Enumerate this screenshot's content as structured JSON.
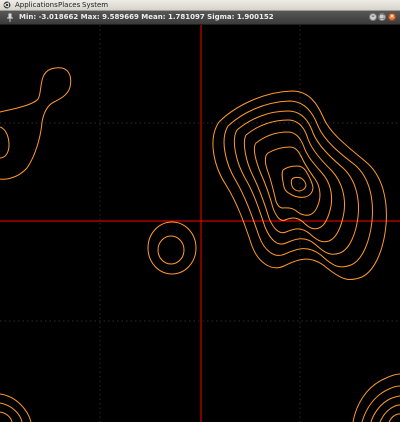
{
  "top_panel": {
    "menus": [
      "Applications",
      "Places",
      "System"
    ],
    "logo_icon": "ubuntu-logo-icon"
  },
  "window": {
    "title": "Min: -3.018662 Max: 9.589669 Mean: 1.781097 Sigma: 1.900152",
    "app_icon": "window-pin-icon",
    "controls": [
      "minimize-icon",
      "maximize-icon",
      "close-icon"
    ]
  },
  "plot": {
    "background_color": "#000000",
    "grid_color": "#3a3a3a",
    "crosshair_color": "#ff0000",
    "contour_color": "#ff9a2e",
    "grid_style": "dotted",
    "crosshair": "visible"
  }
}
